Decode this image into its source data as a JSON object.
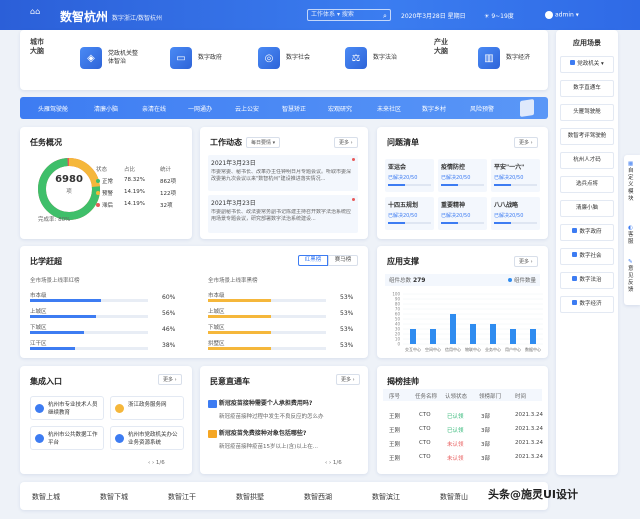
{
  "header": {
    "title": "数智杭州",
    "subtitle": "数字浙江/数智杭州",
    "tab_select": "工作体系",
    "tab_arrow": "▾",
    "search_placeholder": "搜索",
    "date": "2020年3月28日",
    "weekday": "星期日",
    "weather": "9~19度",
    "user": "admin"
  },
  "city_brain": {
    "left_label": "城市大脑",
    "right_label": "产业大脑"
  },
  "top_items": [
    "党政机关整体智治",
    "数字政府",
    "数字社会",
    "数字法治",
    "数字经济"
  ],
  "nav_items": [
    "头雁驾驶舱",
    "清廉小脑",
    "亲清在线",
    "一网通办",
    "云上公安",
    "智慧矫正",
    "宏观研究",
    "未来社区",
    "数字乡村",
    "风险预警"
  ],
  "task": {
    "title": "任务概况",
    "total": "6980",
    "unit": "项",
    "headers": [
      "状态",
      "占比",
      "统计"
    ],
    "rows": [
      {
        "status": "正常",
        "pct": "78.32%",
        "count": "862项",
        "color": "#3fbf6a"
      },
      {
        "status": "预警",
        "pct": "14.19%",
        "count": "122项",
        "color": "#f5b73b"
      },
      {
        "status": "滞后",
        "pct": "14.19%",
        "count": "32项",
        "color": "#e85a5a"
      }
    ],
    "complete_label": "完成率:",
    "complete_rate": "80%"
  },
  "work": {
    "title": "工作动态",
    "select": "每日要情",
    "more": "更多",
    "items": [
      {
        "date": "2021年3月23日",
        "text": "市委常委、秘书长、改革办主任钟明日月专题会议。听取市委深改委第九次会议以来\"数智杭州\"建设推进落实情况..."
      },
      {
        "date": "2021年3月23日",
        "text": "市委副秘书长、政法委常务副书记陈建主持召开数字法治系统应用场景专题会议，研究部署数字法治系统建设..."
      }
    ]
  },
  "issues": {
    "title": "问题清单",
    "more": "更多",
    "items": [
      {
        "name": "亚运会",
        "solved": "已解决20/50"
      },
      {
        "name": "疫情防控",
        "solved": "已解决20/50"
      },
      {
        "name": "平安\"一六\"",
        "solved": "已解决20/50"
      },
      {
        "name": "十四五规划",
        "solved": "已解决20/50"
      },
      {
        "name": "重要精神",
        "solved": "已解决20/50"
      },
      {
        "name": "八八战略",
        "solved": "已解决20/50"
      }
    ]
  },
  "compare": {
    "title": "比学赶超",
    "tab_red": "红黑榜",
    "tab_race": "赛马榜",
    "left_sub": "全市场景上线率红榜",
    "right_sub": "全市场景上线率黑榜",
    "left_rows": [
      {
        "name": "市本级",
        "pct": "60%",
        "fill": 0.6
      },
      {
        "name": "上城区",
        "pct": "56%",
        "fill": 0.56
      },
      {
        "name": "下城区",
        "pct": "46%",
        "fill": 0.46
      },
      {
        "name": "江干区",
        "pct": "38%",
        "fill": 0.38
      }
    ],
    "right_rows": [
      {
        "name": "市本级",
        "pct": "53%",
        "fill": 0.53
      },
      {
        "name": "上城区",
        "pct": "53%",
        "fill": 0.53
      },
      {
        "name": "下城区",
        "pct": "53%",
        "fill": 0.53
      },
      {
        "name": "拱墅区",
        "pct": "53%",
        "fill": 0.53
      }
    ]
  },
  "support": {
    "title": "应用支撑",
    "more": "更多",
    "label": "组件总数",
    "total": "279",
    "legend": "组件数量"
  },
  "chart_data": {
    "type": "bar",
    "categories": [
      "交互中心",
      "空间中心",
      "信用中心",
      "物联中心",
      "业务中心",
      "用户中心",
      "数据中心"
    ],
    "values": [
      30,
      30,
      60,
      40,
      40,
      30,
      30
    ],
    "ylim": [
      0,
      100
    ],
    "yticks": [
      0,
      10,
      20,
      30,
      40,
      50,
      60,
      70,
      80,
      90,
      100
    ],
    "grid": true,
    "legend": "top-right",
    "series": [
      {
        "name": "组件数量",
        "values": [
          30,
          30,
          60,
          40,
          40,
          30,
          30
        ]
      }
    ]
  },
  "integration": {
    "title": "集成入口",
    "more": "更多",
    "items": [
      "杭州市专业技术人员继续教育",
      "浙江政务服务网",
      "杭州市公共数据工作平台",
      "杭州市党政机关办公业务资源系统"
    ],
    "page": "1/6"
  },
  "news": {
    "title": "民意直通车",
    "more": "更多",
    "items": [
      {
        "title": "新冠疫苗接种需要个人承担费用吗?",
        "sub": "新冠疫苗接种过程中发生不良反应的怎么办"
      },
      {
        "title": "新冠疫苗免费接种对象包括哪些?",
        "sub": "新冠疫苗接种疫苗15岁以上(含)以上在..."
      }
    ],
    "page": "1/6"
  },
  "listing": {
    "title": "揭榜挂帅",
    "headers": [
      "序号",
      "任务名称",
      "认领状态",
      "领榜部门",
      "时间"
    ],
    "rows": [
      {
        "no": "",
        "name": "王刚",
        "task": "CTO",
        "status": "已认领",
        "dept": "3部",
        "time": "2021.3.24",
        "color": "#2bb673"
      },
      {
        "no": "",
        "name": "王刚",
        "task": "CTO",
        "status": "已认领",
        "dept": "3部",
        "time": "2021.3.24",
        "color": "#2bb673"
      },
      {
        "no": "",
        "name": "王刚",
        "task": "CTO",
        "status": "未认领",
        "dept": "3部",
        "time": "2021.3.24",
        "color": "#e85a5a"
      },
      {
        "no": "",
        "name": "王刚",
        "task": "CTO",
        "status": "未认领",
        "dept": "3部",
        "time": "2021.3.24",
        "color": "#e85a5a"
      }
    ]
  },
  "footer": [
    "数智上城",
    "数智下城",
    "数智江干",
    "数智拱墅",
    "数智西湖",
    "数智滨江",
    "数智萧山"
  ],
  "watermark": "头条@施灵UI设计",
  "scenes": {
    "title": "应用场景",
    "items": [
      "党政机关",
      "数字直通车",
      "头雁驾驶舱",
      "数智考评驾驶舱",
      "杭州人才码",
      "选兵点将",
      "清廉小脑",
      "数字政府",
      "数字社会",
      "数字法治",
      "数字经济"
    ]
  },
  "float": [
    "自定义模块",
    "客服",
    "意见反馈"
  ]
}
